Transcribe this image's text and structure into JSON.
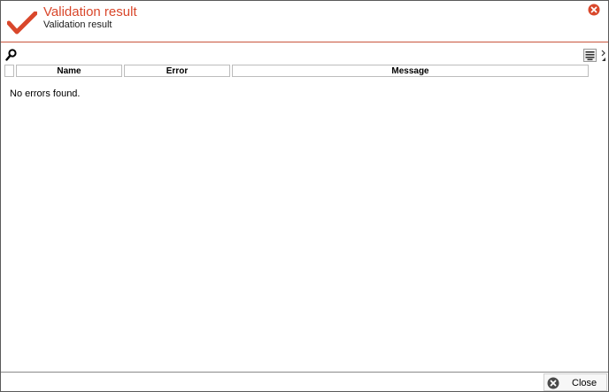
{
  "header": {
    "title": "Validation result",
    "subtitle": "Validation result",
    "accent_color": "#d9472b"
  },
  "table": {
    "columns": [
      "Name",
      "Error",
      "Message"
    ],
    "empty_message": "No errors found."
  },
  "footer": {
    "close_label": "Close"
  },
  "icons": {
    "status": "check-icon",
    "close": "close-x-icon",
    "search": "search-icon",
    "columns": "columns-icon"
  }
}
